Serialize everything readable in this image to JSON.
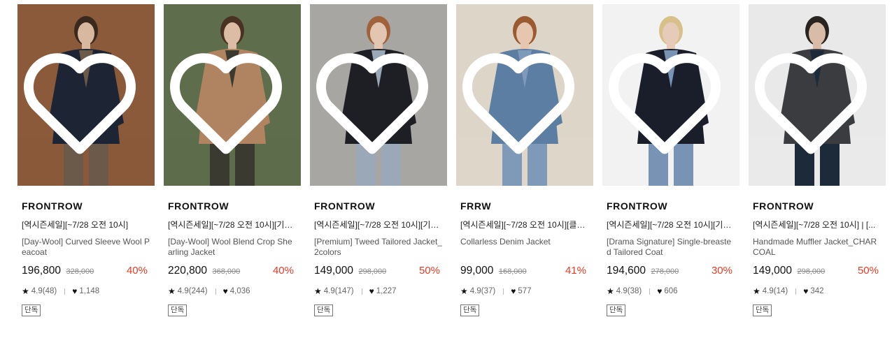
{
  "products": [
    {
      "brand": "FRONTROW",
      "promo": "[역시즌세일][~7/28 오전 10시]",
      "name": "[Day-Wool] Curved Sleeve Wool Peacoat",
      "price": "196,800",
      "original_price": "328,000",
      "discount": "40%",
      "rating": "4.9(48)",
      "likes": "1,148",
      "badge": "단독",
      "colors": {
        "bg": "#8a5a3a",
        "garment": "#1d2433",
        "accent": "#6b5a4a",
        "skin": "#d9b8a0",
        "hair": "#3a2a1e"
      }
    },
    {
      "brand": "FRONTROW",
      "promo": "[역시즌세일][~7/28 오전 10시][기…",
      "name": "[Day-Wool] Wool Blend Crop Shearling Jacket",
      "price": "220,800",
      "original_price": "368,000",
      "discount": "40%",
      "rating": "4.9(244)",
      "likes": "4,036",
      "badge": "단독",
      "colors": {
        "bg": "#5e6e4c",
        "garment": "#b08460",
        "accent": "#3a3a30",
        "skin": "#dcbca4",
        "hair": "#4a3222"
      }
    },
    {
      "brand": "FRONTROW",
      "promo": "[역시즌세일][~7/28 오전 10시][기…",
      "name": "[Premium] Tweed Tailored Jacket_2colors",
      "price": "149,000",
      "original_price": "298,000",
      "discount": "50%",
      "rating": "4.9(147)",
      "likes": "1,227",
      "badge": "단독",
      "colors": {
        "bg": "#a8a6a2",
        "garment": "#1e1f24",
        "accent": "#9aa8b8",
        "skin": "#e2c6b2",
        "hair": "#a0623a"
      }
    },
    {
      "brand": "FRRW",
      "promo": "[역시즌세일][~7/28 오전 10시][클…",
      "name": "Collarless Denim Jacket",
      "price": "99,000",
      "original_price": "168,000",
      "discount": "41%",
      "rating": "4.9(37)",
      "likes": "577",
      "badge": "단독",
      "colors": {
        "bg": "#ddd6c8",
        "garment": "#5d7ea3",
        "accent": "#7f9ab8",
        "skin": "#e6c6ae",
        "hair": "#9a5a32"
      }
    },
    {
      "brand": "FRONTROW",
      "promo": "[역시즌세일][~7/28 오전 10시][기…",
      "name": "[Drama Signature] Single-breasted Tailored Coat",
      "price": "194,600",
      "original_price": "278,000",
      "discount": "30%",
      "rating": "4.9(38)",
      "likes": "606",
      "badge": "단독",
      "colors": {
        "bg": "#f2f2f2",
        "garment": "#1a1e2a",
        "accent": "#7893b3",
        "skin": "#e6cbb8",
        "hair": "#d8c08a"
      }
    },
    {
      "brand": "FRONTROW",
      "promo": "[역시즌세일][~7/28 오전 10시] | [...",
      "name": "Handmade Muffler Jacket_CHARCOAL",
      "price": "149,000",
      "original_price": "298,000",
      "discount": "50%",
      "rating": "4.9(14)",
      "likes": "342",
      "badge": "단독",
      "colors": {
        "bg": "#e9e9e9",
        "garment": "#3a3c40",
        "accent": "#1c2a3a",
        "skin": "#d8bca8",
        "hair": "#2a2420"
      }
    }
  ]
}
